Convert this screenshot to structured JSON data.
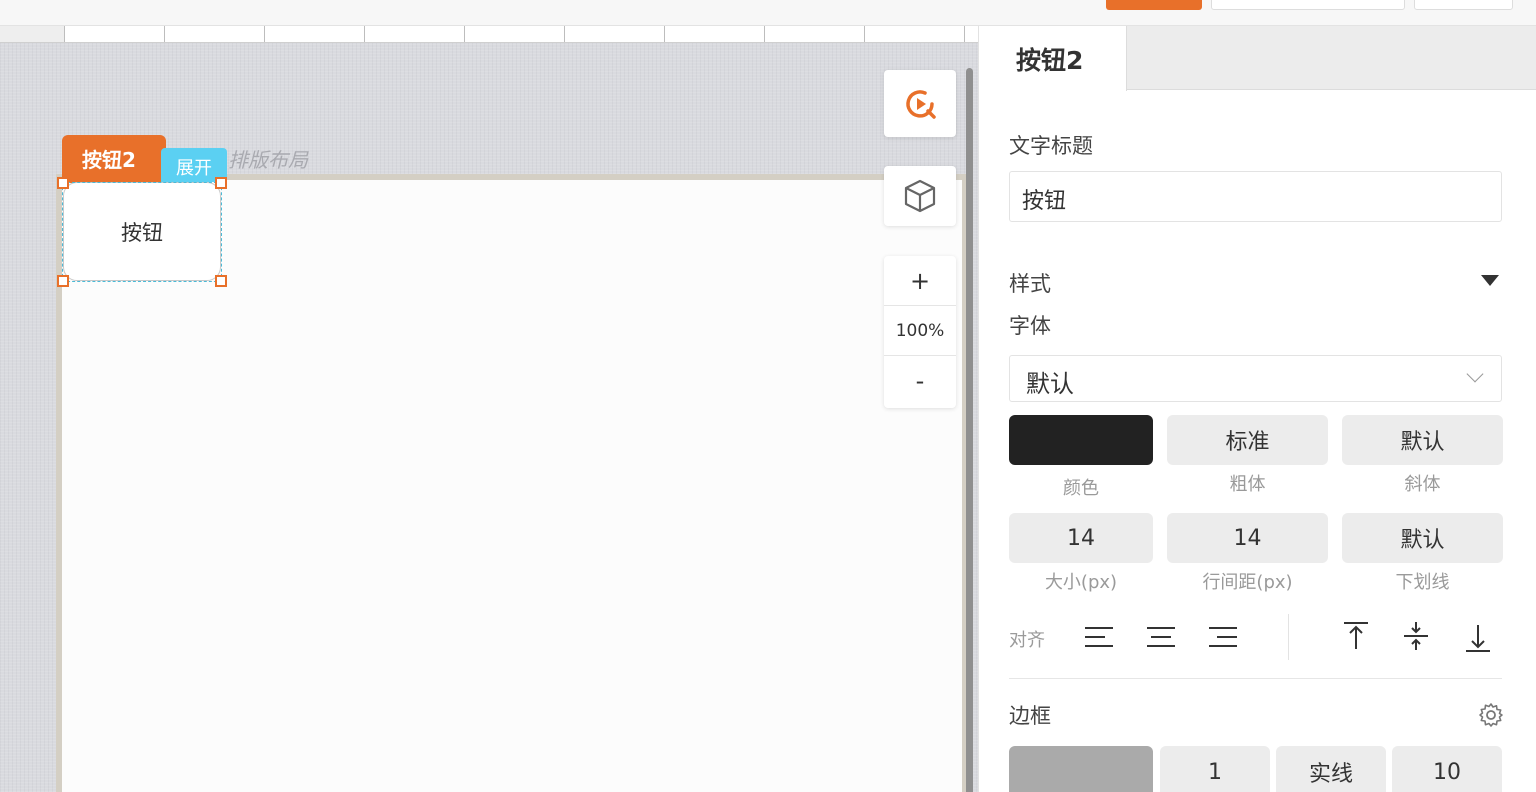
{
  "canvas": {
    "layout_label": "排版布局",
    "selected_component": {
      "tag_label": "按钮2",
      "expand_label": "展开",
      "button_text": "按钮"
    },
    "tools": {
      "preview_icon": "play-circle-icon",
      "3d_icon": "cube-icon",
      "zoom_in": "+",
      "zoom_level": "100%",
      "zoom_out": "-"
    }
  },
  "panel": {
    "tab_title": "按钮2",
    "text_title_label": "文字标题",
    "text_title_value": "按钮",
    "style_section": "样式",
    "font_label": "字体",
    "font_value": "默认",
    "font_buttons": [
      {
        "value": "",
        "caption": "颜色"
      },
      {
        "value": "标准",
        "caption": "粗体"
      },
      {
        "value": "默认",
        "caption": "斜体"
      }
    ],
    "size_buttons": [
      {
        "value": "14",
        "caption": "大小(px)"
      },
      {
        "value": "14",
        "caption": "行间距(px)"
      },
      {
        "value": "默认",
        "caption": "下划线"
      }
    ],
    "align_label": "对齐",
    "border_label": "边框",
    "border_values": {
      "width": "1",
      "style": "实线",
      "radius": "10"
    }
  },
  "colors": {
    "accent": "#e8702a",
    "expand_tag": "#5bd0f2",
    "text_color_swatch": "#222222",
    "border_color_swatch": "#aaaaaa"
  }
}
